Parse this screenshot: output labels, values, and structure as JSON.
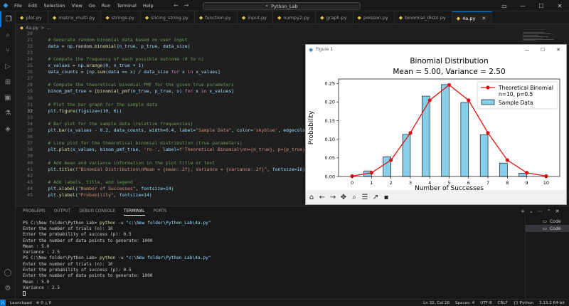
{
  "titlebar": {
    "menu": [
      "File",
      "Edit",
      "Selection",
      "View",
      "Go",
      "Run",
      "Terminal",
      "Help"
    ],
    "search": "Python_Lab"
  },
  "tabs": [
    {
      "label": "plot.py",
      "active": false
    },
    {
      "label": "matrix_multi.py",
      "active": false
    },
    {
      "label": "strings.py",
      "active": false
    },
    {
      "label": "slicing_string.py",
      "active": false
    },
    {
      "label": "function.py",
      "active": false
    },
    {
      "label": "input.py",
      "active": false
    },
    {
      "label": "numpy2.py",
      "active": false
    },
    {
      "label": "graph.py",
      "active": false
    },
    {
      "label": "poisson.py",
      "active": false
    },
    {
      "label": "binomial_distri.py",
      "active": false
    },
    {
      "label": "4a.py",
      "active": true
    }
  ],
  "breadcrumb": {
    "file": "4a.py",
    "sep": ">",
    "more": "..."
  },
  "editor": {
    "lines": [
      {
        "n": "20",
        "parts": []
      },
      {
        "n": "21",
        "parts": [
          {
            "t": "    # Generate random binomial data based on user input",
            "c": "c-cmt"
          }
        ]
      },
      {
        "n": "22",
        "parts": [
          {
            "t": "    data",
            "c": "c-var"
          },
          {
            "t": " = ",
            "c": "c-txt"
          },
          {
            "t": "np",
            "c": "c-var"
          },
          {
            "t": ".random.",
            "c": "c-txt"
          },
          {
            "t": "binomial",
            "c": "c-fn"
          },
          {
            "t": "(n_true, p_true, data_size)",
            "c": "c-var"
          }
        ]
      },
      {
        "n": "23",
        "parts": []
      },
      {
        "n": "24",
        "parts": [
          {
            "t": "    # Compute the frequency of each possible outcome (0 to n)",
            "c": "c-cmt"
          }
        ]
      },
      {
        "n": "25",
        "parts": [
          {
            "t": "    x_values",
            "c": "c-var"
          },
          {
            "t": " = ",
            "c": "c-txt"
          },
          {
            "t": "np",
            "c": "c-var"
          },
          {
            "t": ".",
            "c": "c-txt"
          },
          {
            "t": "arange",
            "c": "c-fn"
          },
          {
            "t": "(0, n_true + 1)",
            "c": "c-var"
          }
        ]
      },
      {
        "n": "26",
        "parts": [
          {
            "t": "    data_counts",
            "c": "c-var"
          },
          {
            "t": " = [",
            "c": "c-txt"
          },
          {
            "t": "np",
            "c": "c-var"
          },
          {
            "t": ".",
            "c": "c-txt"
          },
          {
            "t": "sum",
            "c": "c-fn"
          },
          {
            "t": "(data == x) / data_size ",
            "c": "c-var"
          },
          {
            "t": "for",
            "c": "c-kw"
          },
          {
            "t": " x ",
            "c": "c-var"
          },
          {
            "t": "in",
            "c": "c-kw"
          },
          {
            "t": " x_values]",
            "c": "c-var"
          }
        ]
      },
      {
        "n": "27",
        "parts": []
      },
      {
        "n": "28",
        "parts": [
          {
            "t": "    # Compute the theoretical binomial PMF for the given true parameters",
            "c": "c-cmt"
          }
        ]
      },
      {
        "n": "29",
        "parts": [
          {
            "t": "    binom_pmf_true",
            "c": "c-var"
          },
          {
            "t": " = [",
            "c": "c-txt"
          },
          {
            "t": "binomial_pmf",
            "c": "c-fn"
          },
          {
            "t": "(n_true, p_true, x) ",
            "c": "c-var"
          },
          {
            "t": "for",
            "c": "c-kw"
          },
          {
            "t": " x ",
            "c": "c-var"
          },
          {
            "t": "in",
            "c": "c-kw"
          },
          {
            "t": " x_values]",
            "c": "c-var"
          }
        ]
      },
      {
        "n": "30",
        "parts": []
      },
      {
        "n": "31",
        "parts": [
          {
            "t": "    # Plot the bar graph for the sample data",
            "c": "c-cmt"
          }
        ]
      },
      {
        "n": "32",
        "parts": [
          {
            "t": "    plt",
            "c": "c-var"
          },
          {
            "t": ".",
            "c": "c-txt"
          },
          {
            "t": "figure",
            "c": "c-fn"
          },
          {
            "t": "(figsize=(10, 6))",
            "c": "c-var"
          }
        ],
        "current": true
      },
      {
        "n": "33",
        "parts": []
      },
      {
        "n": "34",
        "parts": [
          {
            "t": "    # Bar plot for the sample data (relative frequencies)",
            "c": "c-cmt"
          }
        ]
      },
      {
        "n": "35",
        "parts": [
          {
            "t": "    plt",
            "c": "c-var"
          },
          {
            "t": ".",
            "c": "c-txt"
          },
          {
            "t": "bar",
            "c": "c-fn"
          },
          {
            "t": "(x_values - 0.2, data_counts, width=0.4, label=",
            "c": "c-var"
          },
          {
            "t": "\"Sample Data\"",
            "c": "c-str"
          },
          {
            "t": ", color=",
            "c": "c-var"
          },
          {
            "t": "'skyblue'",
            "c": "c-str"
          },
          {
            "t": ", edgecolor=",
            "c": "c-var"
          }
        ]
      },
      {
        "n": "36",
        "parts": []
      },
      {
        "n": "37",
        "parts": [
          {
            "t": "    # Line plot for the theoretical binomial distribution (true parameters)",
            "c": "c-cmt"
          }
        ]
      },
      {
        "n": "38",
        "parts": [
          {
            "t": "    plt",
            "c": "c-var"
          },
          {
            "t": ".",
            "c": "c-txt"
          },
          {
            "t": "plot",
            "c": "c-fn"
          },
          {
            "t": "(x_values, binom_pmf_true, ",
            "c": "c-var"
          },
          {
            "t": "'ro-'",
            "c": "c-str"
          },
          {
            "t": ", label=",
            "c": "c-var"
          },
          {
            "t": "f'Theoretical Binomial\\nn={n_true}, p={p_true}'",
            "c": "c-str"
          },
          {
            "t": ",",
            "c": "c-var"
          }
        ]
      },
      {
        "n": "39",
        "parts": []
      },
      {
        "n": "40",
        "parts": [
          {
            "t": "    # Add mean and variance information in the plot title or text",
            "c": "c-cmt"
          }
        ]
      },
      {
        "n": "41",
        "parts": [
          {
            "t": "    plt",
            "c": "c-var"
          },
          {
            "t": ".",
            "c": "c-txt"
          },
          {
            "t": "title",
            "c": "c-fn"
          },
          {
            "t": "(",
            "c": "c-var"
          },
          {
            "t": "f\"Binomial Distribution\\nMean = {mean:.2f}, Variance = {variance:.2f}\"",
            "c": "c-str"
          },
          {
            "t": ", fontsize=16)",
            "c": "c-var"
          }
        ]
      },
      {
        "n": "42",
        "parts": []
      },
      {
        "n": "43",
        "parts": [
          {
            "t": "    # Add labels, title, and legend",
            "c": "c-cmt"
          }
        ]
      },
      {
        "n": "44",
        "parts": [
          {
            "t": "    plt",
            "c": "c-var"
          },
          {
            "t": ".",
            "c": "c-txt"
          },
          {
            "t": "xlabel",
            "c": "c-fn"
          },
          {
            "t": "(",
            "c": "c-var"
          },
          {
            "t": "\"Number of Successes\"",
            "c": "c-str"
          },
          {
            "t": ", fontsize=14)",
            "c": "c-var"
          }
        ]
      },
      {
        "n": "45",
        "parts": [
          {
            "t": "    plt",
            "c": "c-var"
          },
          {
            "t": ".",
            "c": "c-txt"
          },
          {
            "t": "ylabel",
            "c": "c-fn"
          },
          {
            "t": "(",
            "c": "c-var"
          },
          {
            "t": "\"Probability\"",
            "c": "c-str"
          },
          {
            "t": ", fontsize=14)",
            "c": "c-var"
          }
        ]
      }
    ]
  },
  "figure": {
    "window_title": "Figure 1",
    "toolbar_icons": [
      "home-icon",
      "back-icon",
      "forward-icon",
      "pan-icon",
      "zoom-icon",
      "configure-icon",
      "edit-axes-icon",
      "save-icon"
    ]
  },
  "chart_data": {
    "type": "bar",
    "title": "Binomial Distribution\nMean = 5.00, Variance = 2.50",
    "xlabel": "Number of Successes",
    "ylabel": "Probability",
    "x": [
      0,
      1,
      2,
      3,
      4,
      5,
      6,
      7,
      8,
      9,
      10
    ],
    "xlim": [
      -0.7,
      10.7
    ],
    "ylim": [
      0,
      0.262
    ],
    "yticks": [
      "0.00",
      "0.05",
      "0.10",
      "0.15",
      "0.20",
      "0.25"
    ],
    "xticks": [
      "0",
      "1",
      "2",
      "3",
      "4",
      "5",
      "6",
      "7",
      "8",
      "9",
      "10"
    ],
    "bar_offset": -0.2,
    "bar_width": 0.4,
    "series": [
      {
        "name": "Sample Data",
        "type": "bar",
        "color": "#87ceeb",
        "values": [
          0.0,
          0.015,
          0.053,
          0.113,
          0.216,
          0.247,
          0.199,
          0.112,
          0.036,
          0.009,
          0.0
        ]
      },
      {
        "name": "Theoretical Binomial\nn=10, p=0.5",
        "type": "line",
        "color": "#e01010",
        "values": [
          0.001,
          0.01,
          0.044,
          0.117,
          0.205,
          0.246,
          0.205,
          0.117,
          0.044,
          0.01,
          0.001
        ]
      }
    ],
    "legend": "top-right",
    "grid": false
  },
  "panel": {
    "tabs": [
      "PROBLEMS",
      "OUTPUT",
      "DEBUG CONSOLE",
      "TERMINAL",
      "PORTS"
    ],
    "active_tab": "TERMINAL",
    "terminals": [
      "Code",
      "Code"
    ]
  },
  "terminal": {
    "lines": [
      {
        "prompt": "PS C:\\New folder\\Python_Lab> ",
        "cmd": "python",
        "args": " -u ",
        "path": "\"c:\\New folder\\Python_Lab\\4a.py\""
      },
      {
        "text": "Enter the number of trials (n): 10"
      },
      {
        "text": "Enter the probability of success (p): 0.5"
      },
      {
        "text": "Enter the number of data points to generate: 1000"
      },
      {
        "text": "Mean : 5.0"
      },
      {
        "text": "Variance : 2.5"
      },
      {
        "prompt": "PS C:\\New folder\\Python_Lab> ",
        "cmd": "python",
        "args": " -u ",
        "path": "\"c:\\New folder\\Python_Lab\\4a.py\""
      },
      {
        "text": "Enter the number of trials (n): 10"
      },
      {
        "text": "Enter the probability of success (p): 0.5"
      },
      {
        "text": "Enter the number of data points to generate: 1000"
      },
      {
        "text": "Mean : 5.0"
      },
      {
        "text": "Variance : 2.5"
      }
    ]
  },
  "statusbar": {
    "left": [
      "Launchpad",
      "⊗ 0 △ 0"
    ],
    "right": [
      "Ln 32, Col 28",
      "Spaces: 4",
      "UTF-8",
      "CRLF",
      "{} Python",
      "3.13.2 64-bit"
    ]
  }
}
